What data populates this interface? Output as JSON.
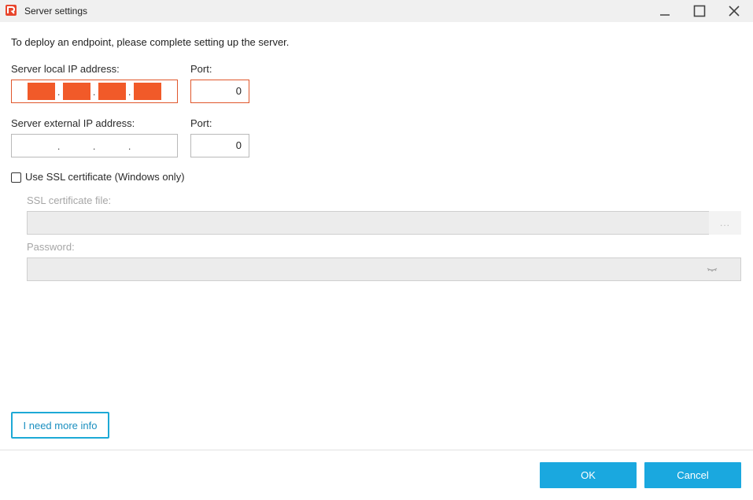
{
  "window": {
    "title": "Server settings",
    "icon": "app-logo-icon"
  },
  "intro_text": "To deploy an endpoint, please complete setting up the server.",
  "local": {
    "label": "Server local IP address:",
    "port_label": "Port:",
    "port_value": "0",
    "ip_segments_redacted": true
  },
  "external": {
    "label": "Server external IP address:",
    "port_label": "Port:",
    "port_value": "0"
  },
  "ssl": {
    "checkbox_label": "Use SSL certificate (Windows only)",
    "checked": false,
    "cert_label": "SSL certificate file:",
    "cert_value": "",
    "browse_label": "...",
    "password_label": "Password:",
    "password_value": ""
  },
  "info_button": "I need more info",
  "ok_button": "OK",
  "cancel_button": "Cancel",
  "colors": {
    "accent": "#1aa8df",
    "error_border": "#e0572c",
    "redaction": "#f15a29"
  }
}
